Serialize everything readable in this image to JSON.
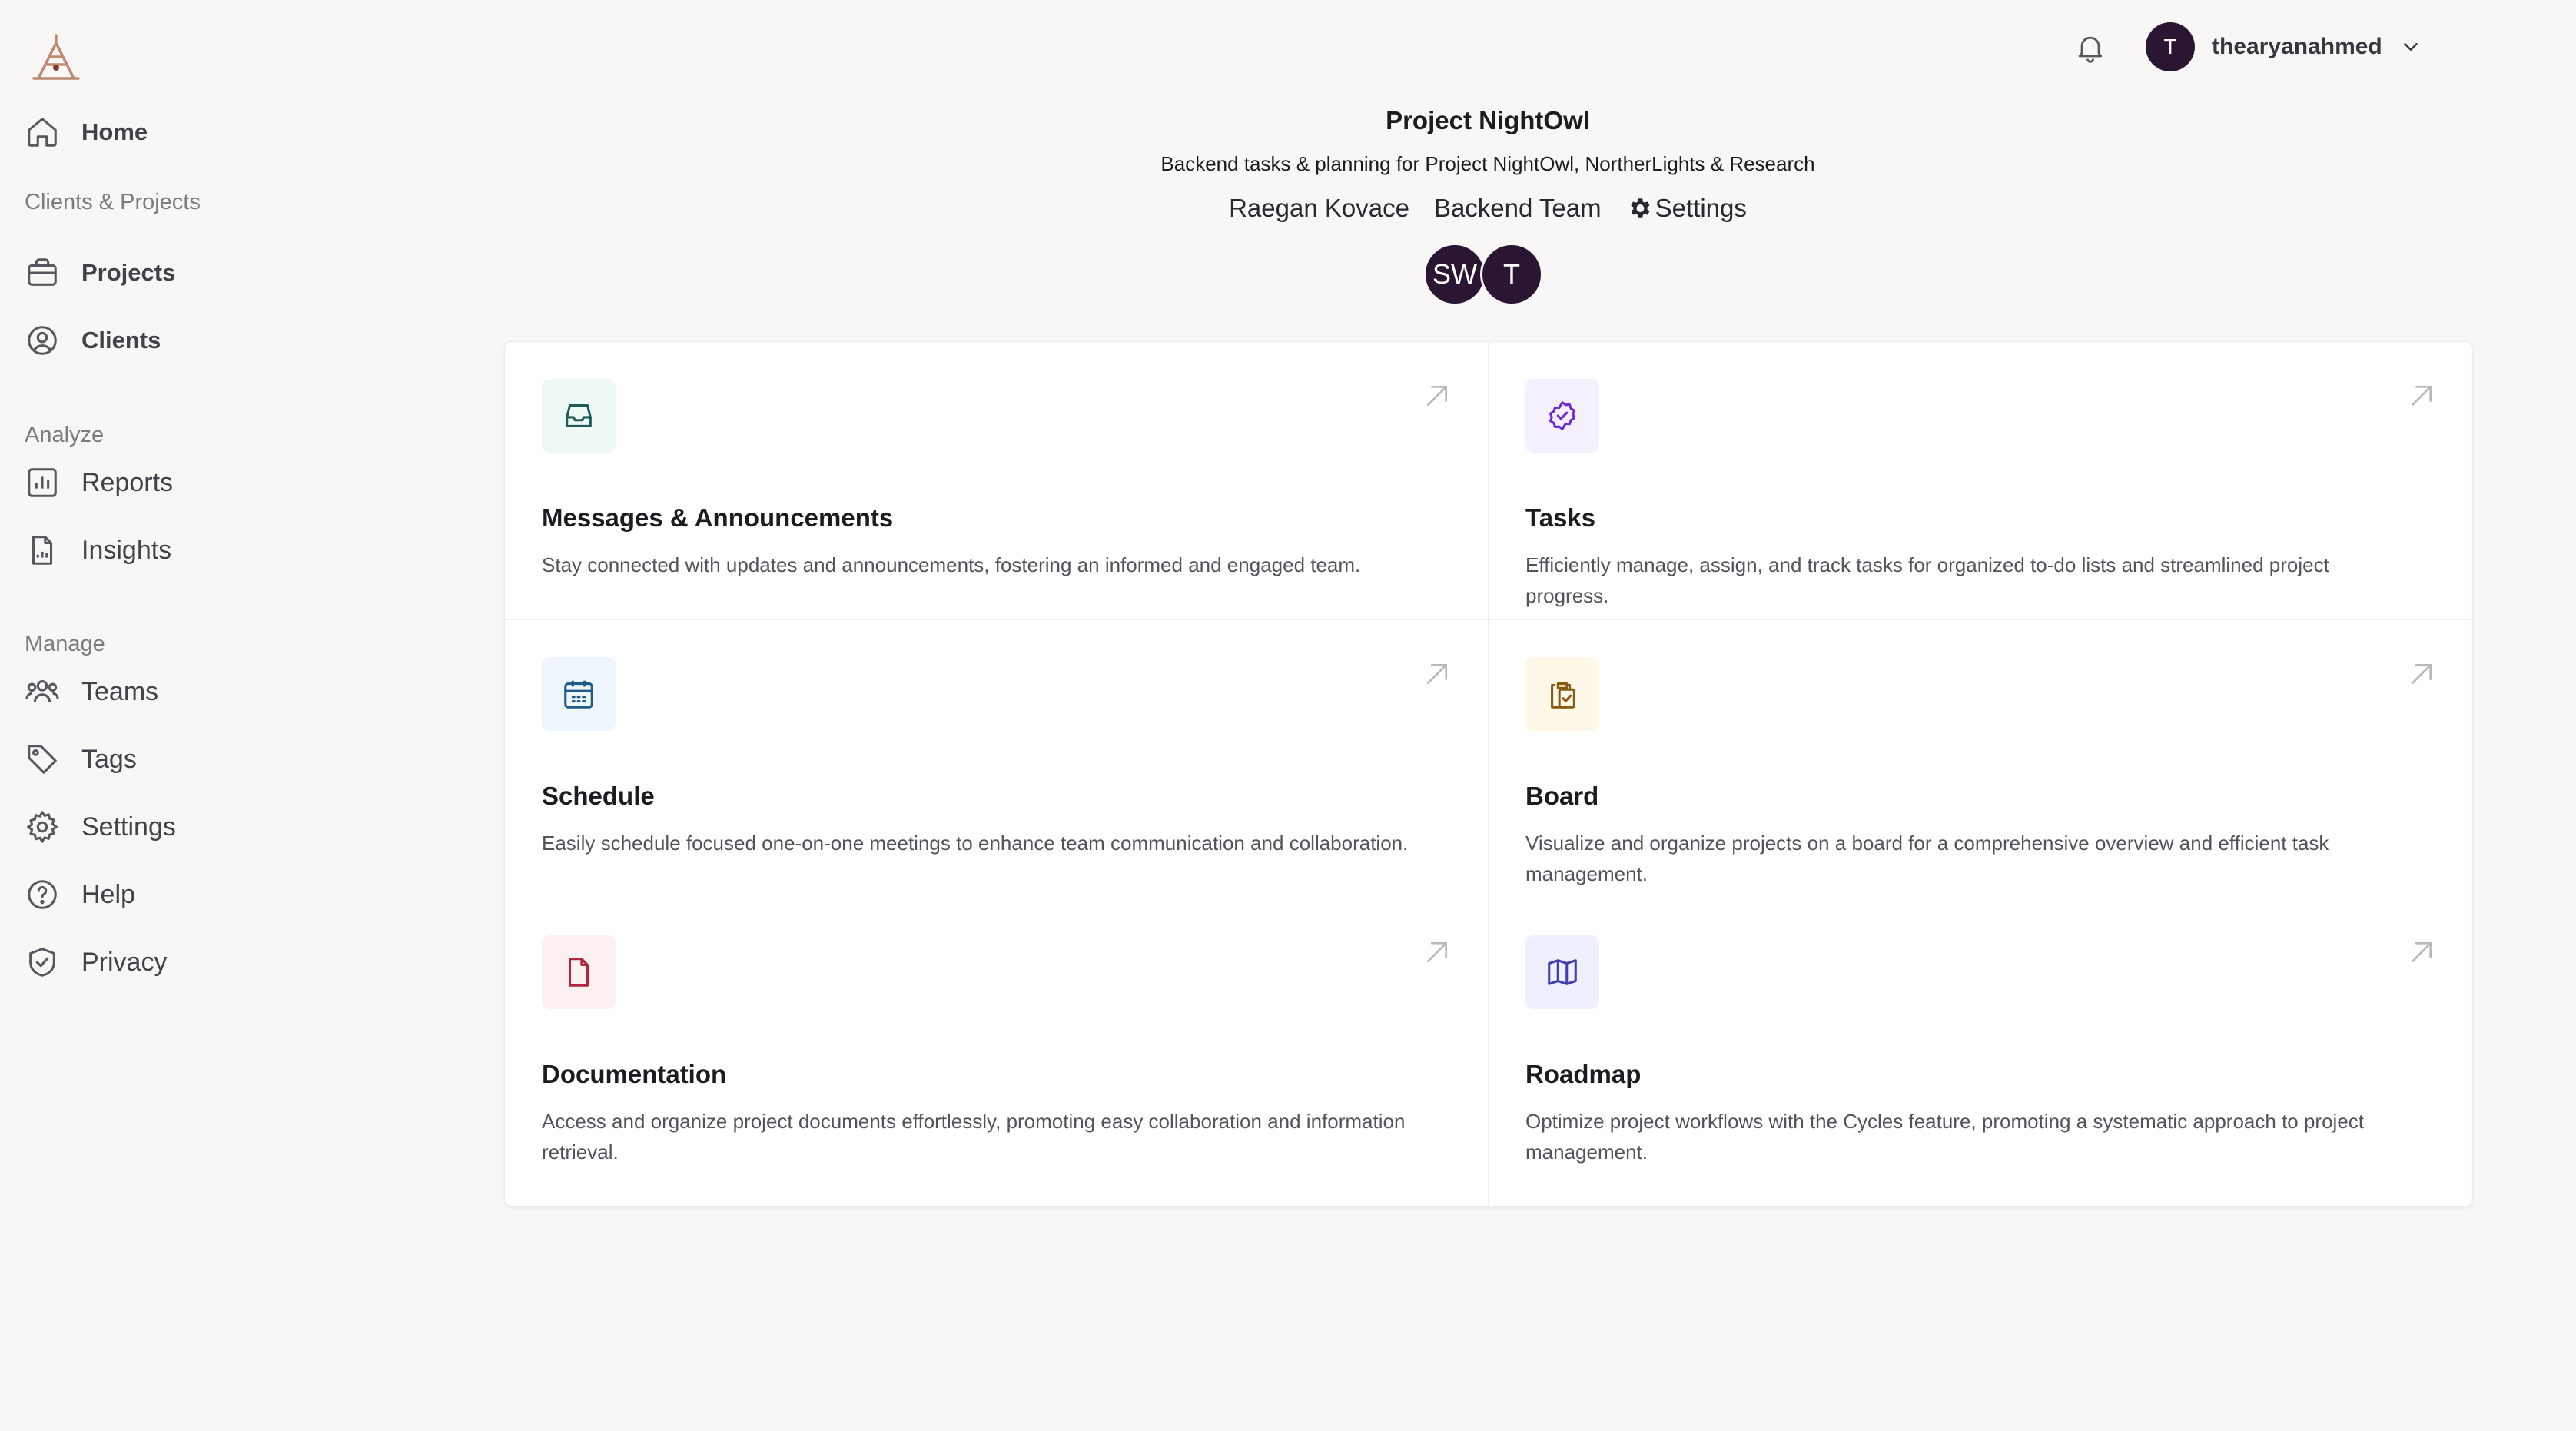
{
  "sidebar": {
    "items": [
      {
        "label": "Home"
      },
      {
        "label": "Projects"
      },
      {
        "label": "Clients"
      },
      {
        "label": "Reports"
      },
      {
        "label": "Insights"
      },
      {
        "label": "Teams"
      },
      {
        "label": "Tags"
      },
      {
        "label": "Settings"
      },
      {
        "label": "Help"
      },
      {
        "label": "Privacy"
      }
    ],
    "sections": [
      "Clients & Projects",
      "Analyze",
      "Manage"
    ]
  },
  "topbar": {
    "user_initial": "T",
    "username": "thearyanahmed"
  },
  "project": {
    "title": "Project NightOwl",
    "subtitle": "Backend tasks & planning for Project NightOwl, NortherLights & Research",
    "owner": "Raegan Kovace",
    "team": "Backend Team",
    "settings_label": "Settings",
    "members": [
      "SW",
      "T"
    ]
  },
  "cards": [
    {
      "title": "Messages & Announcements",
      "desc": "Stay connected with updates and announcements, fostering an informed and engaged team.",
      "icon": "inbox-icon",
      "bg": "#eef8f5",
      "color": "#1f5c58"
    },
    {
      "title": "Tasks",
      "desc": "Efficiently manage, assign, and track tasks for organized to-do lists and streamlined project progress.",
      "icon": "badge-check-icon",
      "bg": "#f5f0fd",
      "color": "#6d28d9"
    },
    {
      "title": "Schedule",
      "desc": "Easily schedule focused one-on-one meetings to enhance team communication and collaboration.",
      "icon": "calendar-icon",
      "bg": "#eef5fb",
      "color": "#1e5a8a"
    },
    {
      "title": "Board",
      "desc": "Visualize and organize projects on a board for a comprehensive overview and efficient task management.",
      "icon": "clipboard-check-icon",
      "bg": "#fdf8e7",
      "color": "#8a5a12"
    },
    {
      "title": "Documentation",
      "desc": "Access and organize project documents effortlessly, promoting easy collaboration and information retrieval.",
      "icon": "document-icon",
      "bg": "#fdf0f1",
      "color": "#b0283c"
    },
    {
      "title": "Roadmap",
      "desc": "Optimize project workflows with the Cycles feature, promoting a systematic approach to project management.",
      "icon": "map-icon",
      "bg": "#eff0fd",
      "color": "#3f3fb5"
    }
  ]
}
